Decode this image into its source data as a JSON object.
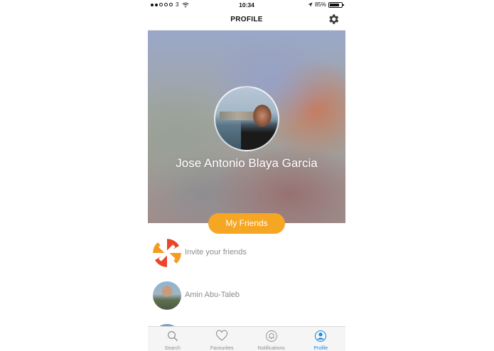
{
  "status_bar": {
    "carrier": "3",
    "time": "10:34",
    "battery": "85%"
  },
  "nav": {
    "title": "PROFILE"
  },
  "profile": {
    "name": "Jose Antonio Blaya Garcia"
  },
  "friends_button": {
    "label": "My Friends"
  },
  "list": [
    {
      "label": "Invite your friends"
    },
    {
      "label": "Amin Abu-Taleb"
    }
  ],
  "tabs": [
    {
      "label": "Search",
      "icon": "search-icon"
    },
    {
      "label": "Favourites",
      "icon": "heart-icon"
    },
    {
      "label": "Notifications",
      "icon": "bell-icon"
    },
    {
      "label": "Profile",
      "icon": "person-icon"
    }
  ],
  "colors": {
    "accent": "#f5a623",
    "active_tab": "#1f8ad9"
  }
}
